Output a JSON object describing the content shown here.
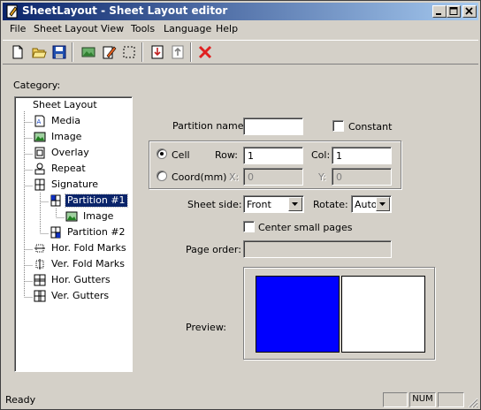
{
  "window": {
    "title": "SheetLayout - Sheet Layout editor",
    "buttons": [
      "minimize",
      "maximize",
      "close"
    ]
  },
  "menu": [
    "File",
    "Sheet Layout",
    "View",
    "Tools",
    "Language",
    "Help"
  ],
  "toolbar": {
    "tools": [
      "new-document-icon",
      "open-folder-icon",
      "save-icon",
      "image-icon",
      "edit-icon",
      "select-rect-icon",
      "import-icon",
      "export-icon",
      "delete-icon"
    ]
  },
  "category": {
    "label": "Category:",
    "tree": [
      {
        "label": "Sheet Layout",
        "icon": "none",
        "level": 0
      },
      {
        "label": "Media",
        "icon": "media-icon",
        "level": 1
      },
      {
        "label": "Image",
        "icon": "image-icon",
        "level": 1
      },
      {
        "label": "Overlay",
        "icon": "overlay-icon",
        "level": 1
      },
      {
        "label": "Repeat",
        "icon": "repeat-icon",
        "level": 1
      },
      {
        "label": "Signature",
        "icon": "signature-icon",
        "level": 1
      },
      {
        "label": "Partition #1",
        "icon": "partition-icon",
        "level": 2,
        "selected": true
      },
      {
        "label": "Image",
        "icon": "image-icon",
        "level": 3
      },
      {
        "label": "Partition #2",
        "icon": "partition-icon",
        "level": 2
      },
      {
        "label": "Hor. Fold Marks",
        "icon": "hor-fold-marks-icon",
        "level": 1
      },
      {
        "label": "Ver. Fold Marks",
        "icon": "ver-fold-marks-icon",
        "level": 1
      },
      {
        "label": "Hor. Gutters",
        "icon": "hor-gutters-icon",
        "level": 1
      },
      {
        "label": "Ver. Gutters",
        "icon": "ver-gutters-icon",
        "level": 1
      }
    ]
  },
  "form": {
    "partition_name_label": "Partition name:",
    "partition_name_value": "",
    "constant_label": "Constant",
    "constant_checked": false,
    "cell_label": "Cell",
    "cell_selected": true,
    "row_label": "Row:",
    "row_value": "1",
    "col_label": "Col:",
    "col_value": "1",
    "coord_label": "Coord(mm)",
    "coord_selected": false,
    "x_label": "X:",
    "x_value": "0",
    "y_label": "Y:",
    "y_value": "0",
    "sheet_side_label": "Sheet side:",
    "sheet_side_value": "Front",
    "rotate_label": "Rotate:",
    "rotate_value": "Auto",
    "center_small_label": "Center small pages",
    "center_small_checked": false,
    "page_order_label": "Page order:",
    "page_order_value": "",
    "preview_label": "Preview:"
  },
  "preview": {
    "left_page_color": "#0000ff",
    "right_page_color": "#ffffff"
  },
  "status": {
    "text": "Ready",
    "panes": [
      "",
      "NUM",
      ""
    ]
  }
}
